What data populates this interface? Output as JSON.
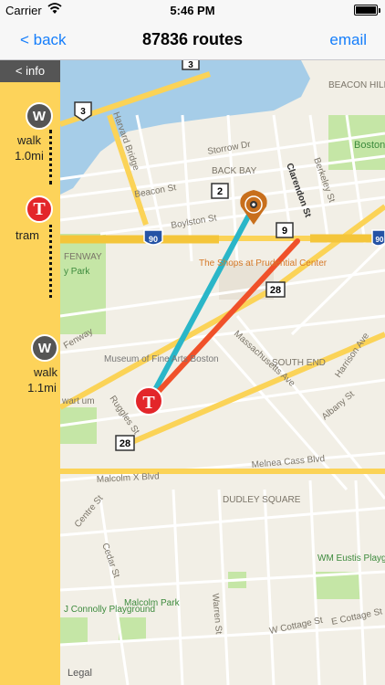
{
  "status_bar": {
    "carrier": "Carrier",
    "time": "5:46 PM"
  },
  "nav": {
    "back_label": "< back",
    "title": "87836 routes",
    "email_label": "email"
  },
  "panel": {
    "info_label": "< info",
    "steps": [
      {
        "icon": "W",
        "mode": "walk",
        "distance": "1.0mi"
      },
      {
        "icon": "T",
        "mode": "tram",
        "distance": ""
      },
      {
        "icon": "W",
        "mode": "walk",
        "distance": "1.1mi"
      }
    ]
  },
  "map": {
    "labels": {
      "beacon_hill": "BEACON HILL",
      "boston": "Boston",
      "harvard_bridge": "Harvard Bridge",
      "storrow": "Storrow Dr",
      "back_bay": "BACK BAY",
      "beacon_st": "Beacon St",
      "clarendon": "Clarendon St",
      "berkeley": "Berkeley St",
      "boylston": "Boylston St",
      "fenway": "FENWAY",
      "park": "y Park",
      "shops": "The Shops at Prudential Center",
      "fenway2": "Fenway",
      "museum": "Museum of Fine Arts Boston",
      "south_end": "SOUTH END",
      "mass_ave": "Massachusetts Ave",
      "harrison": "Harrison Ave",
      "albany": "Albany St",
      "ruggles": "Ruggles St",
      "stewart": "wart um",
      "melnea": "Melnea Cass Blvd",
      "malcolm_x": "Malcolm X Blvd",
      "centre": "Centre St",
      "dudley": "DUDLEY SQUARE",
      "cedar": "Cedar St",
      "warren": "Warren St",
      "wm_eustis": "WM Eustis Playground",
      "connolly": "J Connolly Playground",
      "malcolm_park": "Malcolm Park",
      "w_cottage": "W Cottage St",
      "e_cottage": "E Cottage St",
      "legal": "Legal"
    },
    "shields": {
      "r3": "3",
      "r3b": "3",
      "r2": "2",
      "i90": "90",
      "i90b": "90",
      "r9": "9",
      "r28a": "28",
      "r28b": "28"
    },
    "colors": {
      "route_blue": "#2ab6c8",
      "route_red": "#f0512a",
      "water": "#a6cde8",
      "park": "#c5e6a6",
      "highway": "#fbd357",
      "pin": "#c86f1c",
      "tram_red": "#e3262a"
    },
    "markers": {
      "tram_icon": "T",
      "pin": "location-pin-icon"
    }
  }
}
